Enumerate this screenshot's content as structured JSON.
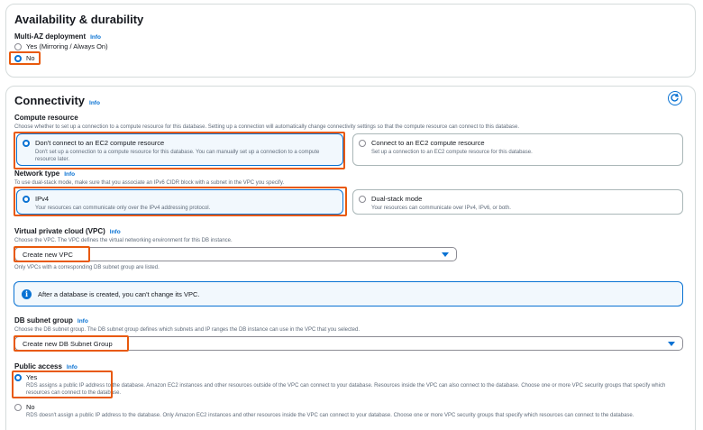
{
  "availability": {
    "title": "Availability & durability",
    "multi_az": {
      "label": "Multi-AZ deployment",
      "info": "Info",
      "options": [
        {
          "label": "Yes (Mirroring / Always On)",
          "selected": false
        },
        {
          "label": "No",
          "selected": true
        }
      ]
    }
  },
  "connectivity": {
    "title": "Connectivity",
    "info": "Info",
    "compute_resource": {
      "label": "Compute resource",
      "description": "Choose whether to set up a connection to a compute resource for this database. Setting up a connection will automatically change connectivity settings so that the compute resource can connect to this database.",
      "options": [
        {
          "title": "Don't connect to an EC2 compute resource",
          "desc": "Don't set up a connection to a compute resource for this database. You can manually set up a connection to a compute resource later.",
          "selected": true
        },
        {
          "title": "Connect to an EC2 compute resource",
          "desc": "Set up a connection to an EC2 compute resource for this database.",
          "selected": false
        }
      ]
    },
    "network_type": {
      "label": "Network type",
      "info": "Info",
      "description": "To use dual-stack mode, make sure that you associate an IPv6 CIDR block with a subnet in the VPC you specify.",
      "options": [
        {
          "title": "IPv4",
          "desc": "Your resources can communicate only over the IPv4 addressing protocol.",
          "selected": true
        },
        {
          "title": "Dual-stack mode",
          "desc": "Your resources can communicate over IPv4, IPv6, or both.",
          "selected": false
        }
      ]
    },
    "vpc": {
      "label": "Virtual private cloud (VPC)",
      "info": "Info",
      "description": "Choose the VPC. The VPC defines the virtual networking environment for this DB instance.",
      "value": "Create new VPC",
      "hint": "Only VPCs with a corresponding DB subnet group are listed."
    },
    "alert": "After a database is created, you can't change its VPC.",
    "subnet_group": {
      "label": "DB subnet group",
      "info": "Info",
      "description": "Choose the DB subnet group. The DB subnet group defines which subnets and IP ranges the DB instance can use in the VPC that you selected.",
      "value": "Create new DB Subnet Group"
    },
    "public_access": {
      "label": "Public access",
      "info": "Info",
      "options": [
        {
          "title": "Yes",
          "desc": "RDS assigns a public IP address to the database. Amazon EC2 instances and other resources outside of the VPC can connect to your database. Resources inside the VPC can also connect to the database. Choose one or more VPC security groups that specify which resources can connect to the database.",
          "selected": true
        },
        {
          "title": "No",
          "desc": "RDS doesn't assign a public IP address to the database. Only Amazon EC2 instances and other resources inside the VPC can connect to your database. Choose one or more VPC security groups that specify which resources can connect to the database.",
          "selected": false
        }
      ]
    }
  },
  "colors": {
    "accent": "#0972d3",
    "highlight": "#e8590c",
    "selected_bg": "#f2f8fd"
  },
  "icons": {
    "refresh": "refresh-icon",
    "info": "info-circle-icon",
    "caret": "caret-down-icon"
  }
}
